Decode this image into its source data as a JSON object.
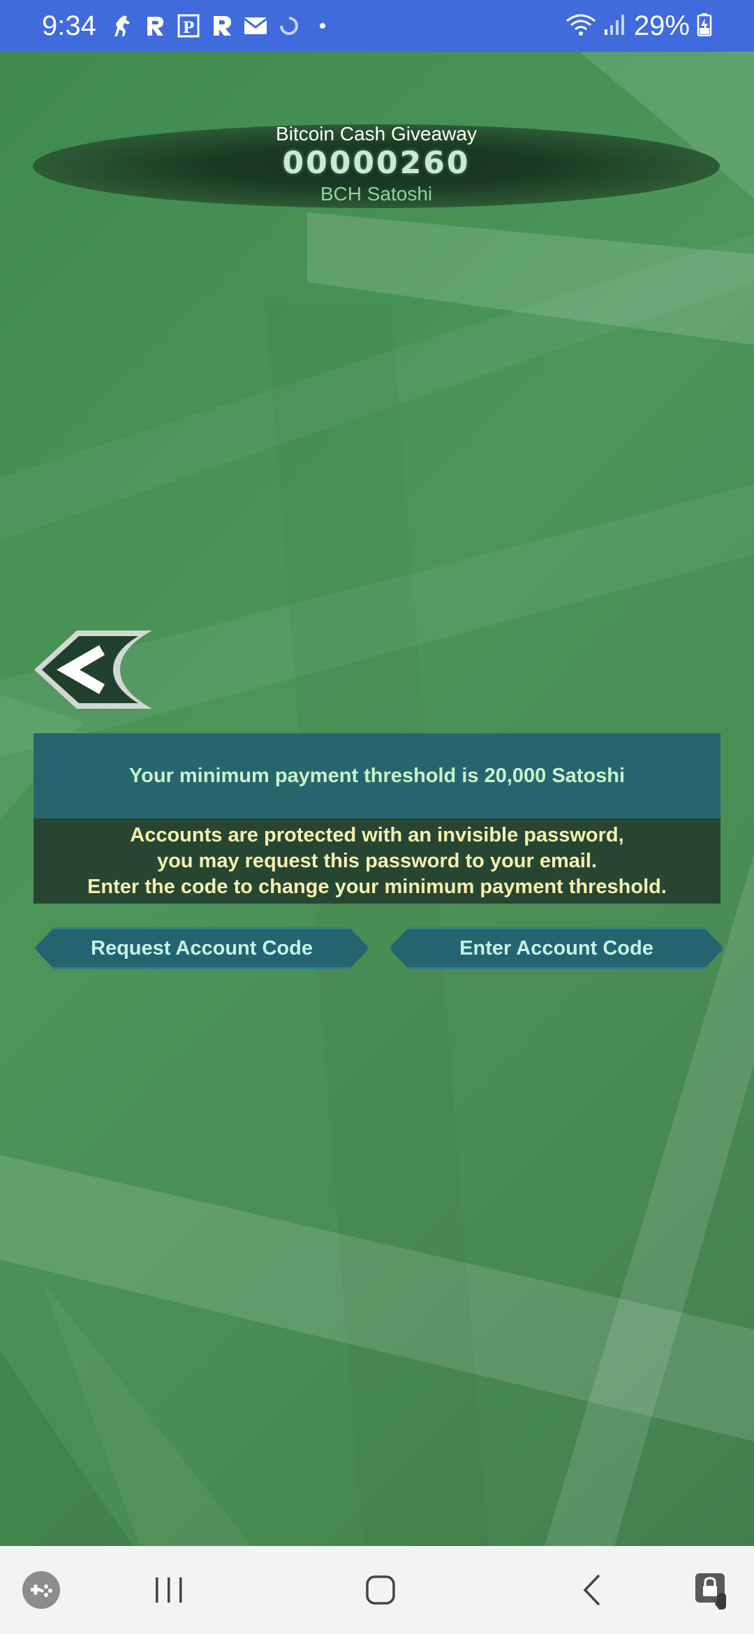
{
  "status_bar": {
    "time": "9:34",
    "battery_percent": "29%",
    "notification_icons": [
      "horse-icon",
      "r-app-icon",
      "parking-icon",
      "r-bold-icon",
      "mail-icon",
      "sync-icon",
      "dot-icon"
    ],
    "background_color": "#3f6bdc"
  },
  "balance": {
    "title": "Bitcoin Cash Giveaway",
    "amount": "00000260",
    "unit": "BCH Satoshi"
  },
  "threshold_notice": "Your minimum payment threshold is 20,000 Satoshi",
  "info": {
    "line1": "Accounts are protected with an invisible password,",
    "line2": "you may request this password to your email.",
    "line3": "Enter the code to change your minimum payment threshold."
  },
  "buttons": {
    "request_label": "Request Account Code",
    "enter_label": "Enter Account Code"
  },
  "nav_bar": {
    "items": [
      "game-launcher-icon",
      "recent-apps-icon",
      "home-icon",
      "back-icon",
      "screen-lock-icon"
    ]
  },
  "colors": {
    "threshold_panel": "#27656e",
    "info_panel": "#264632",
    "button_fill": "#236470",
    "threshold_text": "#c8f5c8",
    "info_text": "#f6f0b0"
  }
}
